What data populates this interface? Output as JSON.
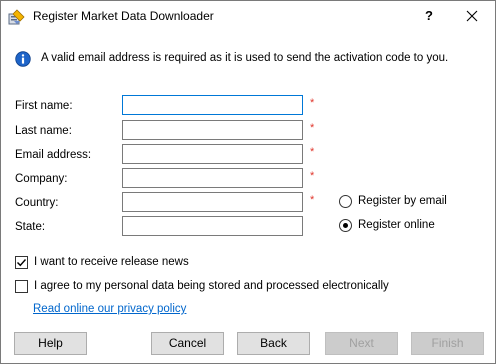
{
  "window": {
    "title": "Register Market Data Downloader",
    "help_label": "?",
    "icon": "app-icon",
    "close_icon": "close-icon"
  },
  "info": {
    "icon": "info-icon",
    "text": "A valid email address is required as it is used to send the activation code to you."
  },
  "form": {
    "required_mark": "*",
    "fields": [
      {
        "label": "First name:",
        "value": "",
        "required": true,
        "focused": true
      },
      {
        "label": "Last name:",
        "value": "",
        "required": true
      },
      {
        "label": "Email address:",
        "value": "",
        "required": true
      },
      {
        "label": "Company:",
        "value": "",
        "required": true
      },
      {
        "label": "Country:",
        "value": "",
        "required": true
      },
      {
        "label": "State:",
        "value": "",
        "required": false
      }
    ]
  },
  "registration": {
    "options": [
      {
        "label": "Register by email",
        "selected": false
      },
      {
        "label": "Register online",
        "selected": true
      }
    ]
  },
  "checkboxes": [
    {
      "label": "I want to receive release news",
      "checked": true
    },
    {
      "label": "I agree to my personal data being stored and processed electronically",
      "checked": false
    }
  ],
  "privacy_link": "Read online our privacy policy",
  "buttons": {
    "help": "Help",
    "cancel": "Cancel",
    "back": "Back",
    "next": "Next",
    "finish": "Finish"
  },
  "colors": {
    "required_star": "#e0352b",
    "link": "#0066cc",
    "focus_border": "#0078d7",
    "disabled_text": "#a0a0a0"
  }
}
